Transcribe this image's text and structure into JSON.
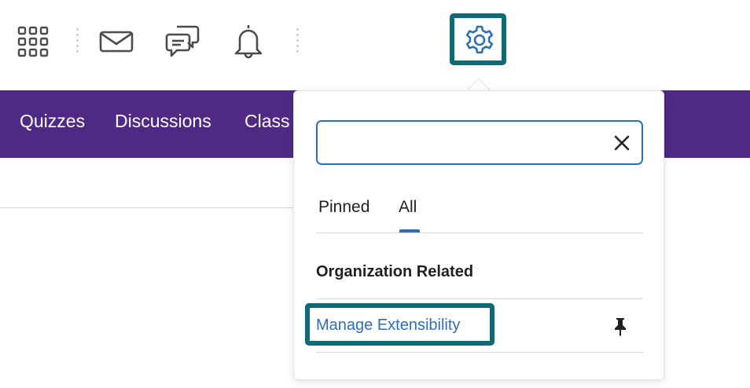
{
  "header": {
    "icons": [
      "waffle-grid-icon",
      "mail-icon",
      "message-icon",
      "bell-icon",
      "gear-icon"
    ]
  },
  "navbar": {
    "items": [
      {
        "label": "Quizzes"
      },
      {
        "label": "Discussions"
      },
      {
        "label": "Class"
      }
    ],
    "background": "#4e2a84"
  },
  "settings_panel": {
    "search": {
      "value": "",
      "placeholder": ""
    },
    "tabs": [
      {
        "label": "Pinned",
        "selected": false
      },
      {
        "label": "All",
        "selected": true
      }
    ],
    "section_heading": "Organization Related",
    "items": [
      {
        "label": "Manage Extensibility"
      }
    ]
  },
  "colors": {
    "accent": "#2d6fb5",
    "highlight": "#0d6a78",
    "nav_purple": "#4e2a84"
  }
}
